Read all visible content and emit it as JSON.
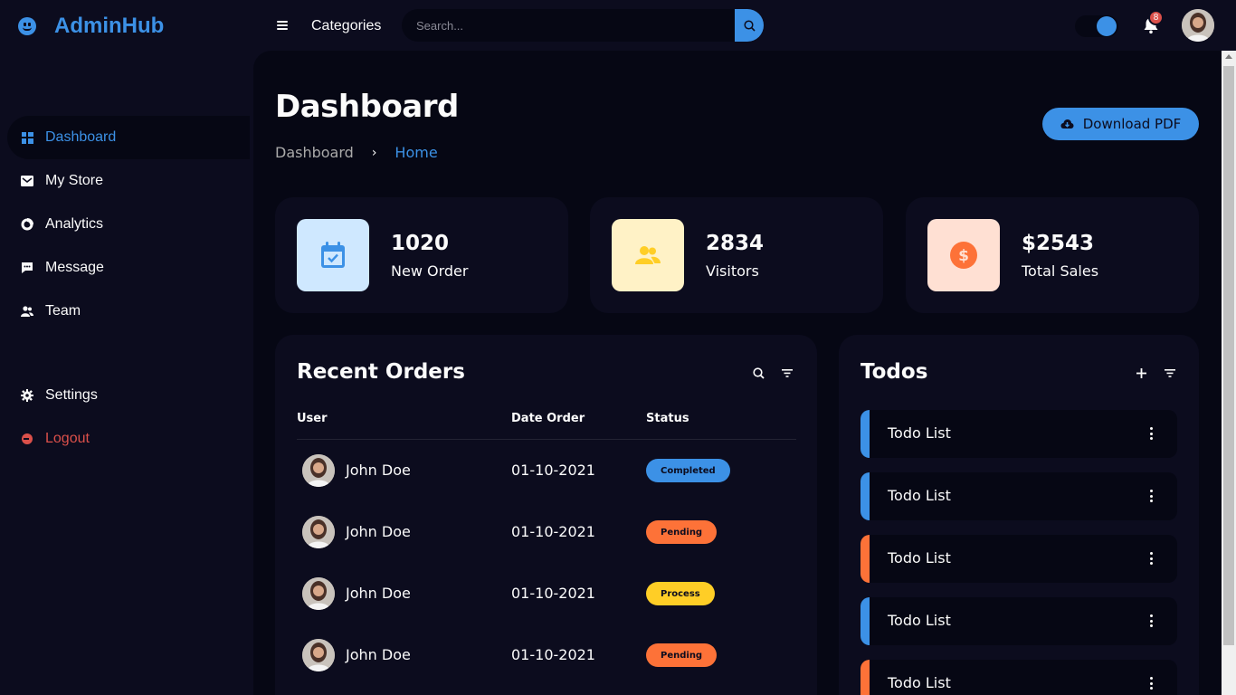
{
  "brand": {
    "name": "AdminHub"
  },
  "sidebar": {
    "items": [
      {
        "label": "Dashboard",
        "icon": "dashboard-icon",
        "active": true
      },
      {
        "label": "My Store",
        "icon": "store-icon"
      },
      {
        "label": "Analytics",
        "icon": "analytics-icon"
      },
      {
        "label": "Message",
        "icon": "message-icon"
      },
      {
        "label": "Team",
        "icon": "team-icon"
      }
    ],
    "bottom": [
      {
        "label": "Settings",
        "icon": "gear-icon"
      },
      {
        "label": "Logout",
        "icon": "logout-icon"
      }
    ]
  },
  "topnav": {
    "categories": "Categories",
    "search_placeholder": "Search...",
    "notification_count": "8"
  },
  "header": {
    "title": "Dashboard",
    "breadcrumb": [
      "Dashboard",
      "Home"
    ],
    "download_label": "Download PDF"
  },
  "stats": [
    {
      "value": "1020",
      "label": "New Order",
      "icon": "calendar-check-icon",
      "bg": "#cfe8ff",
      "fg": "#3c91e6"
    },
    {
      "value": "2834",
      "label": "Visitors",
      "icon": "group-icon",
      "bg": "#fff2c6",
      "fg": "#ffce26"
    },
    {
      "value": "$2543",
      "label": "Total Sales",
      "icon": "dollar-circle-icon",
      "bg": "#ffe0d3",
      "fg": "#fd7238"
    }
  ],
  "orders": {
    "title": "Recent Orders",
    "columns": [
      "User",
      "Date Order",
      "Status"
    ],
    "rows": [
      {
        "user": "John Doe",
        "date": "01-10-2021",
        "status": "Completed",
        "color": "#3c91e6"
      },
      {
        "user": "John Doe",
        "date": "01-10-2021",
        "status": "Pending",
        "color": "#fd7238"
      },
      {
        "user": "John Doe",
        "date": "01-10-2021",
        "status": "Process",
        "color": "#ffce26"
      },
      {
        "user": "John Doe",
        "date": "01-10-2021",
        "status": "Pending",
        "color": "#fd7238"
      }
    ]
  },
  "todos": {
    "title": "Todos",
    "items": [
      {
        "label": "Todo List",
        "color": "#3c91e6"
      },
      {
        "label": "Todo List",
        "color": "#3c91e6"
      },
      {
        "label": "Todo List",
        "color": "#fd7238"
      },
      {
        "label": "Todo List",
        "color": "#3c91e6"
      },
      {
        "label": "Todo List",
        "color": "#fd7238"
      }
    ]
  },
  "colors": {
    "accent": "#3c91e6",
    "danger": "#db504a",
    "panel": "#0c0c1e",
    "background": "#060714"
  }
}
